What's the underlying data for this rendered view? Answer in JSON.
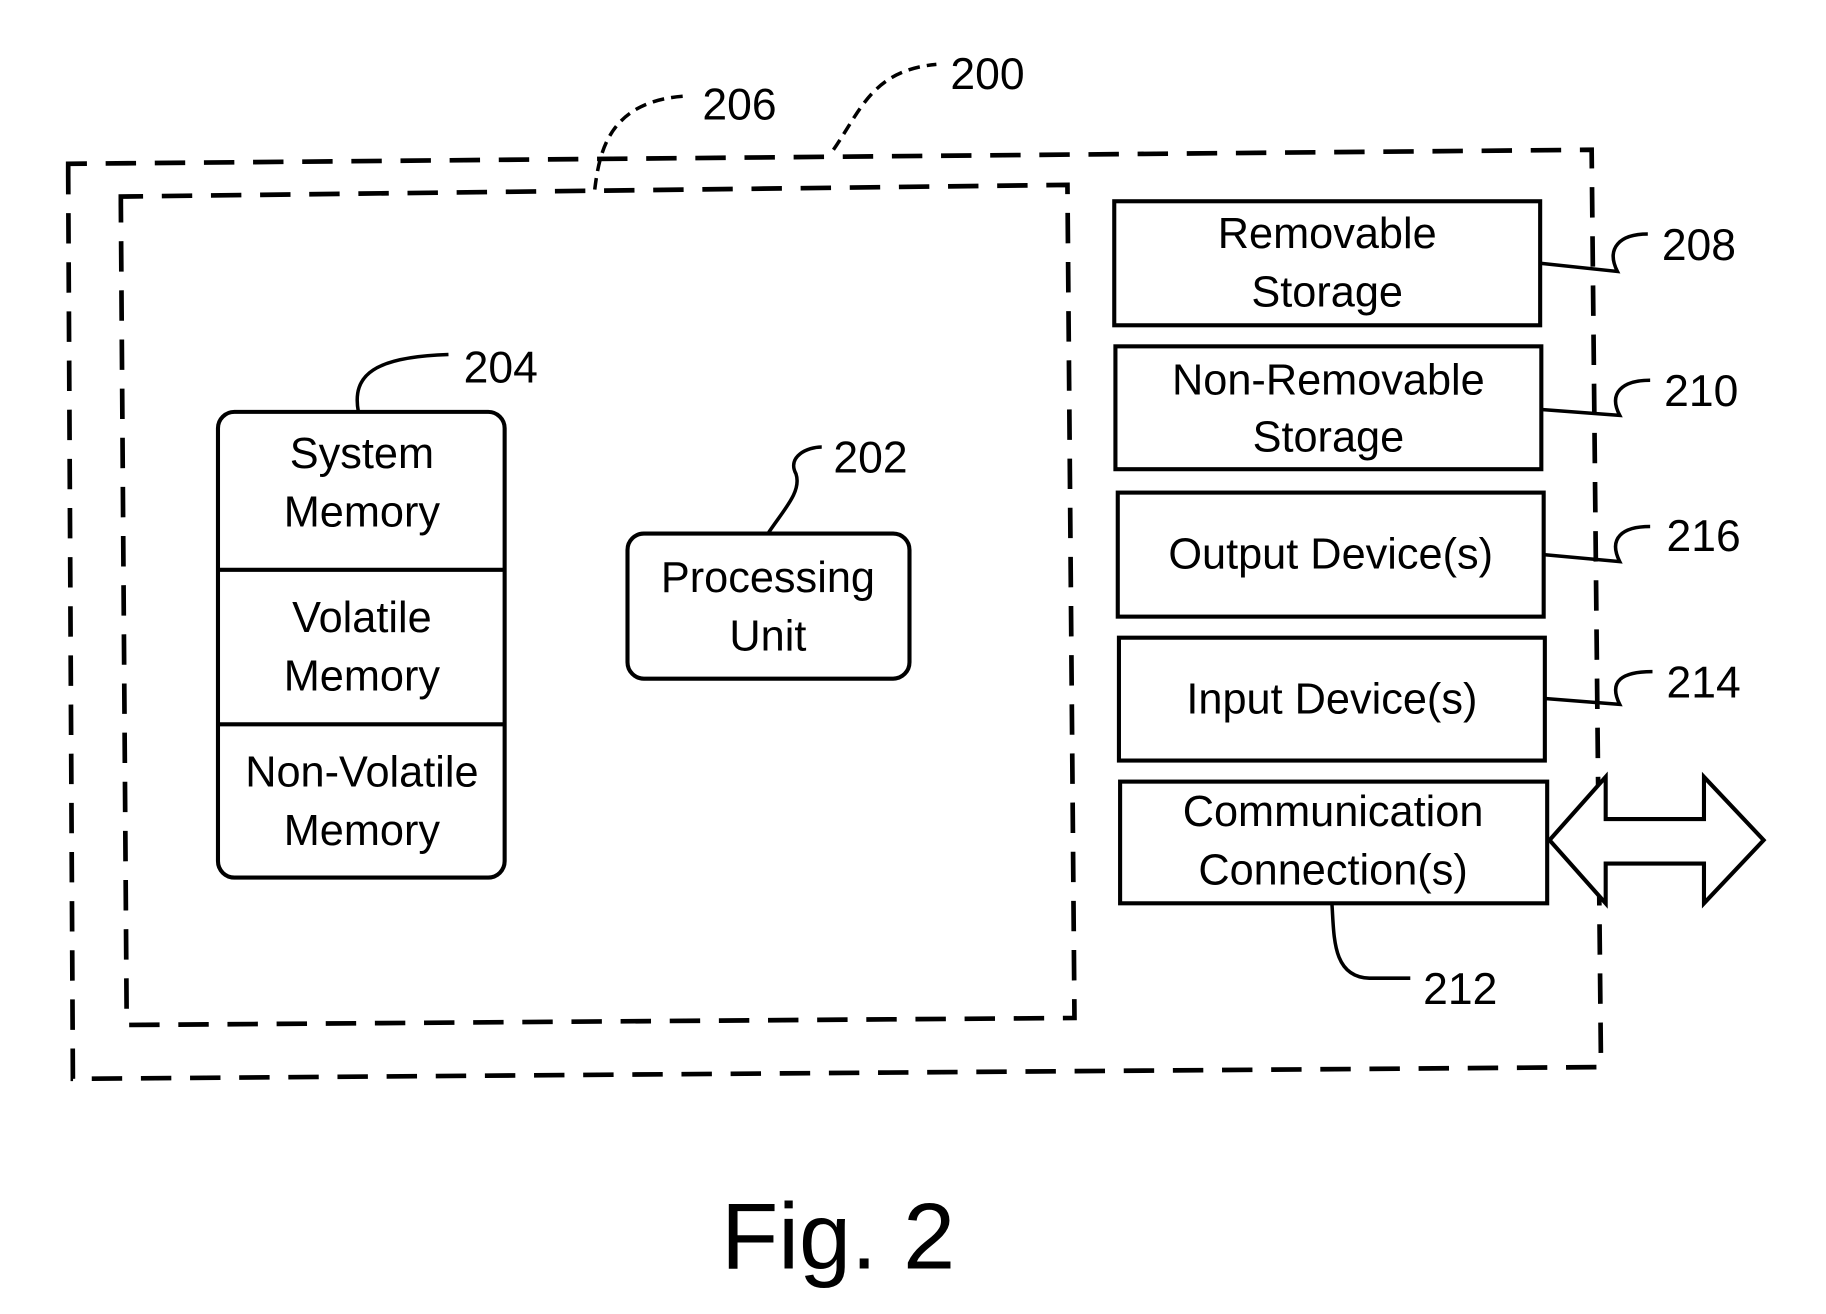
{
  "figure": {
    "caption": "Fig. 2"
  },
  "containers": {
    "computing_device": {
      "ref": "200"
    },
    "basic_configuration": {
      "ref": "206"
    }
  },
  "memory": {
    "ref": "204",
    "sections": [
      {
        "line1": "System",
        "line2": "Memory"
      },
      {
        "line1": "Volatile",
        "line2": "Memory"
      },
      {
        "line1": "Non-Volatile",
        "line2": "Memory"
      }
    ]
  },
  "processing_unit": {
    "ref": "202",
    "line1": "Processing",
    "line2": "Unit"
  },
  "components": [
    {
      "line1": "Removable",
      "line2": "Storage",
      "ref": "208"
    },
    {
      "line1": "Non-Removable",
      "line2": "Storage",
      "ref": "210"
    },
    {
      "line1": "Output Device(s)",
      "line2": "",
      "ref": "216"
    },
    {
      "line1": "Input Device(s)",
      "line2": "",
      "ref": "214"
    },
    {
      "line1": "Communication",
      "line2": "Connection(s)",
      "ref": "212"
    }
  ]
}
